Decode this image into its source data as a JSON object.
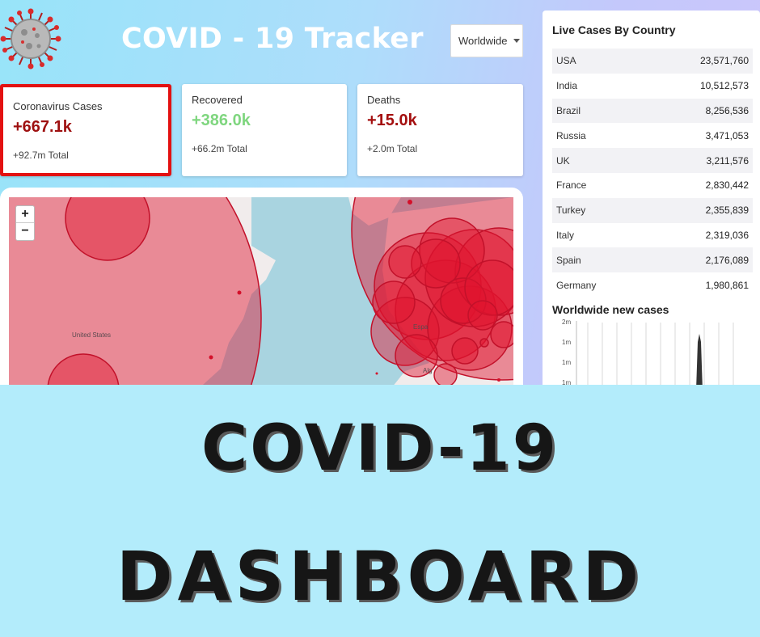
{
  "header": {
    "title": "COVID - 19 Tracker",
    "country_select": "Worldwide"
  },
  "stats": {
    "cases": {
      "title": "Coronavirus Cases",
      "value": "+667.1k",
      "total": "+92.7m Total",
      "color": "#9e1010"
    },
    "recovered": {
      "title": "Recovered",
      "value": "+386.0k",
      "total": "+66.2m Total",
      "color": "#7fd67f"
    },
    "deaths": {
      "title": "Deaths",
      "value": "+15.0k",
      "total": "+2.0m Total",
      "color": "#a40f0f"
    }
  },
  "map": {
    "label_country": "United States",
    "label_spain": "Espa",
    "label_algeria": "Alg",
    "zoom_in": "+",
    "zoom_out": "−",
    "circle_color": "#e0142f"
  },
  "live_cases": {
    "title": "Live Cases By Country",
    "rows": [
      {
        "country": "USA",
        "cases": "23,571,760"
      },
      {
        "country": "India",
        "cases": "10,512,573"
      },
      {
        "country": "Brazil",
        "cases": "8,256,536"
      },
      {
        "country": "Russia",
        "cases": "3,471,053"
      },
      {
        "country": "UK",
        "cases": "3,211,576"
      },
      {
        "country": "France",
        "cases": "2,830,442"
      },
      {
        "country": "Turkey",
        "cases": "2,355,839"
      },
      {
        "country": "Italy",
        "cases": "2,319,036"
      },
      {
        "country": "Spain",
        "cases": "2,176,089"
      },
      {
        "country": "Germany",
        "cases": "1,980,861"
      }
    ]
  },
  "new_cases_chart": {
    "title": "Worldwide new cases",
    "y_ticks": [
      "2m",
      "1m",
      "1m",
      "1m"
    ]
  },
  "headline": {
    "line1": "COVID-19",
    "line2": "DASHBOARD"
  }
}
